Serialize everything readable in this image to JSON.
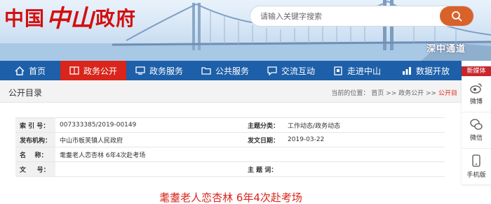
{
  "header": {
    "logo": {
      "part1": "中国",
      "part2": "中山",
      "part3": "政府"
    },
    "search": {
      "placeholder": "请输入关键字搜索"
    },
    "tagline": "深中通道"
  },
  "nav": {
    "items": [
      {
        "label": "首页",
        "icon": "home-icon",
        "active": false
      },
      {
        "label": "政务公开",
        "icon": "book-icon",
        "active": true
      },
      {
        "label": "政务服务",
        "icon": "monitor-icon",
        "active": false
      },
      {
        "label": "公共服务",
        "icon": "folder-icon",
        "active": false
      },
      {
        "label": "交流互动",
        "icon": "speech-bubble-icon",
        "active": false
      },
      {
        "label": "走进中山",
        "icon": "building-icon",
        "active": false
      },
      {
        "label": "数据开放",
        "icon": "bar-chart-icon",
        "active": false
      }
    ]
  },
  "sidebar": {
    "header": "新媒体",
    "items": [
      {
        "label": "微博",
        "icon": "weibo-icon"
      },
      {
        "label": "微信",
        "icon": "wechat-icon"
      },
      {
        "label": "手机版",
        "icon": "mobile-phone-icon"
      }
    ]
  },
  "subheader": {
    "title": "公开目录",
    "breadcrumb": {
      "prefix": "当前的位置：",
      "items": [
        "首页",
        ">>",
        "政务公开",
        ">>"
      ],
      "current": "公开目"
    }
  },
  "info": {
    "index_label": "索 引 号：",
    "index_value": "007333385/2019-00149",
    "category_label": "主题分类：",
    "category_value": "工作动态/政务动态",
    "publisher_label": "发布机构：",
    "publisher_value": "中山市板芙镇人民政府",
    "date_label": "发文日期：",
    "date_value": "2019-03-22",
    "name_label": "名    称：",
    "name_value": "耄耋老人恋杏林 6年4次赴考场",
    "doc_label": "文     号：",
    "doc_value": "",
    "keywords_label": "主 题 词：",
    "keywords_value": ""
  },
  "article": {
    "title": "耄耋老人恋杏林 6年4次赴考场"
  },
  "colors": {
    "brand_red": "#d40f0f",
    "nav_blue": "#1d5fa8",
    "active_red": "#d9251c",
    "search_orange": "#d9622b"
  }
}
